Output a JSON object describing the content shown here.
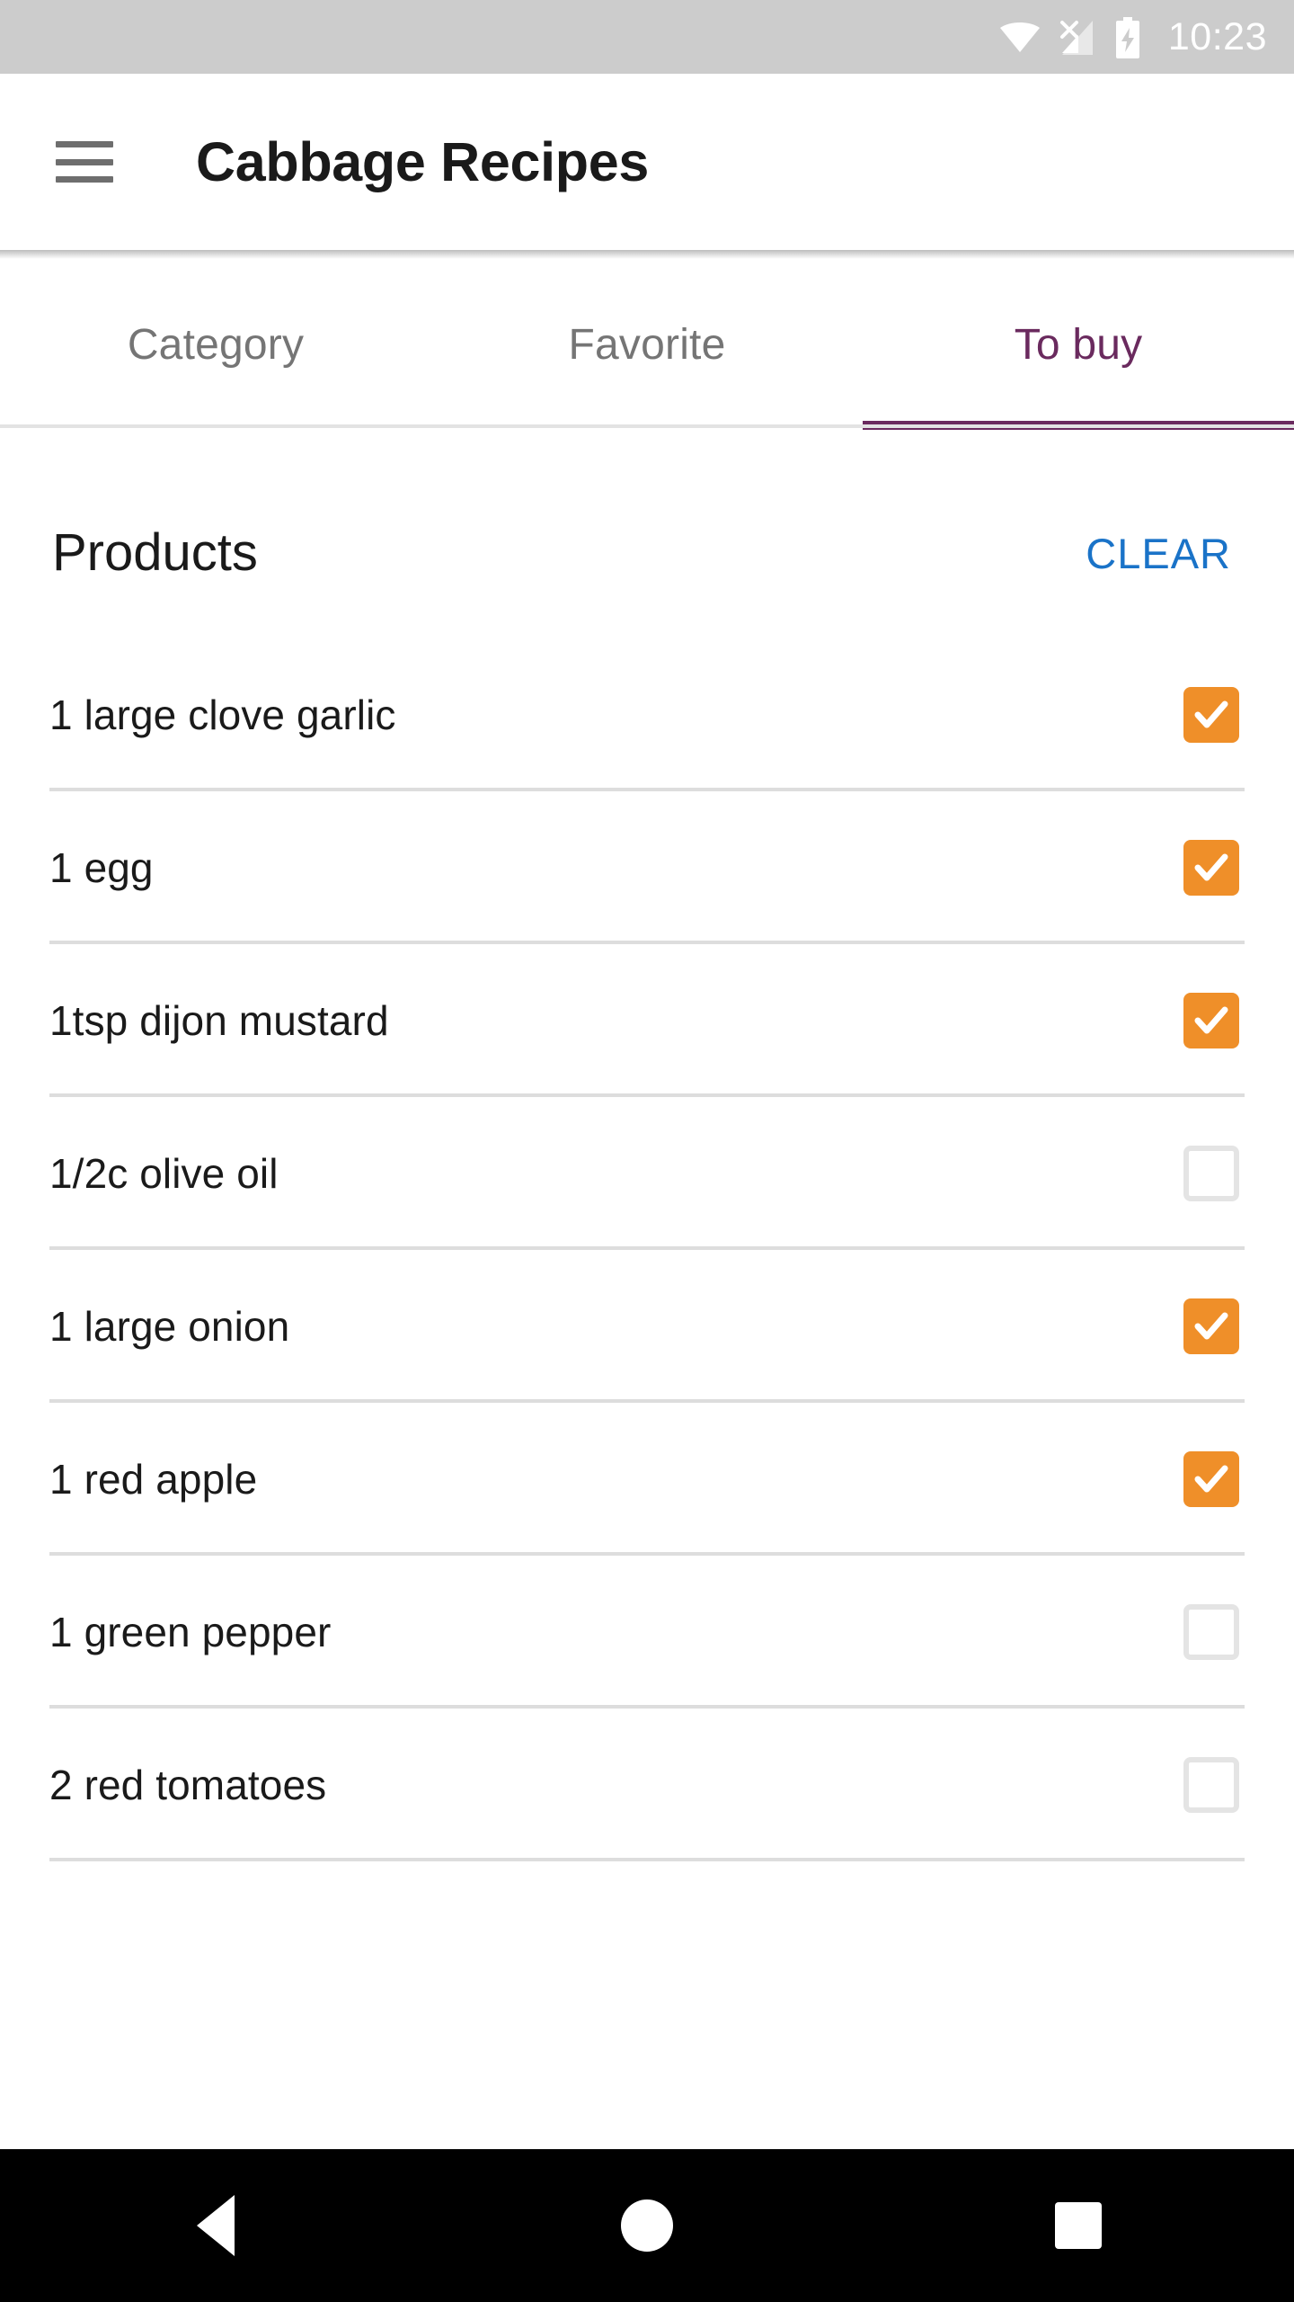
{
  "status_bar": {
    "time": "10:23",
    "icons": [
      "wifi-icon",
      "cellular-no-sim-icon",
      "battery-charging-icon"
    ],
    "background_color": "#cccccc",
    "foreground_color": "#ffffff"
  },
  "app_bar": {
    "menu_icon": "hamburger-menu-icon",
    "title": "Cabbage Recipes"
  },
  "tabs": {
    "items": [
      {
        "label": "Category",
        "active": false
      },
      {
        "label": "Favorite",
        "active": false
      },
      {
        "label": "To buy",
        "active": true
      }
    ],
    "active_color": "#6a2a5e",
    "inactive_color": "#757575"
  },
  "section": {
    "title": "Products",
    "clear_label": "CLEAR",
    "clear_color": "#1a73c8"
  },
  "products": {
    "checked_color": "#ef8f29",
    "unchecked_border_color": "#e4e4e4",
    "items": [
      {
        "label": "1 large clove garlic",
        "checked": true
      },
      {
        "label": "1 egg",
        "checked": true
      },
      {
        "label": "1tsp dijon mustard",
        "checked": true
      },
      {
        "label": "1/2c olive oil",
        "checked": false
      },
      {
        "label": "1 large onion",
        "checked": true
      },
      {
        "label": "1 red apple",
        "checked": true
      },
      {
        "label": "1 green pepper",
        "checked": false
      },
      {
        "label": "2 red tomatoes",
        "checked": false
      }
    ]
  },
  "nav_bar": {
    "buttons": [
      {
        "name": "back-button",
        "icon": "triangle-back-icon"
      },
      {
        "name": "home-button",
        "icon": "circle-home-icon"
      },
      {
        "name": "recents-button",
        "icon": "square-recents-icon"
      }
    ],
    "background_color": "#000000"
  }
}
